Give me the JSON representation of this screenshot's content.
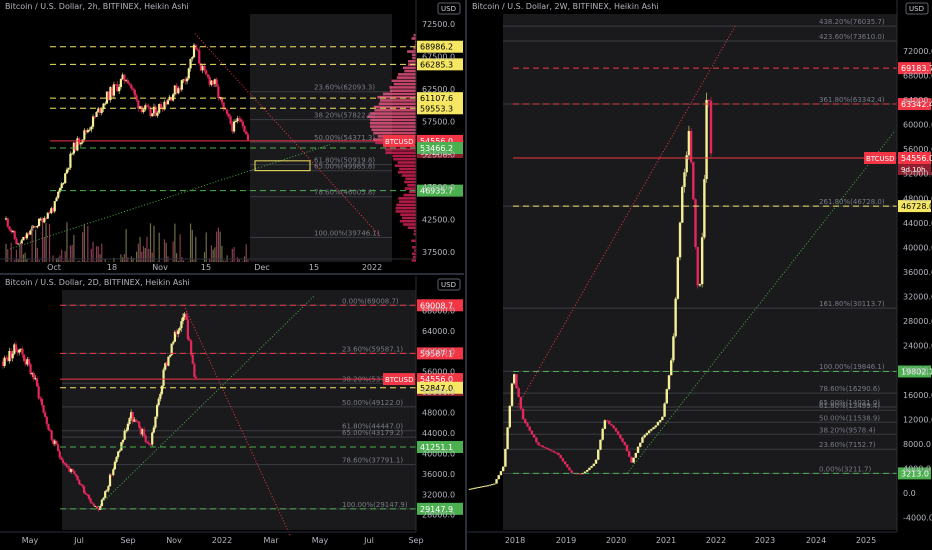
{
  "theme": {
    "bull": "#f5f097",
    "bear": "#e8265e",
    "green": "#4caf50",
    "red": "#f23645",
    "yellow": "#f5e663",
    "fib": "#787b86"
  },
  "charts": {
    "p1": {
      "title": "Bitcoin / U.S. Dollar, 2h, BITFINEX, Heikin Ashi",
      "currency": "USD",
      "ymin": 36000,
      "ymax": 74000,
      "xTicks": [
        "Oct",
        "18",
        "Nov",
        "15",
        "Dec",
        "15",
        "2022"
      ],
      "yTicks": [
        "37500.0",
        "42500.0",
        "47500.0",
        "52500.0",
        "57500.0",
        "62500.0",
        "67500.0",
        "72500.0"
      ],
      "fibLabels": [
        "23.60%(62093.3)",
        "38.20%(57822.8)",
        "50.00%(54371.3)",
        "61.80%(50919.8)",
        "65.00%(49985.8)",
        "78.60%(46005.8)",
        "100.00%(39746.1)"
      ],
      "lines": [
        {
          "name": "level-68986",
          "label": "68986.2",
          "price": 68986.2,
          "color": "#f5e663",
          "dash": true
        },
        {
          "name": "level-66285",
          "label": "66285.3",
          "price": 66285.3,
          "color": "#f5e663",
          "dash": true
        },
        {
          "name": "level-61107",
          "label": "61107.6",
          "price": 61107.6,
          "color": "#f5e663",
          "dash": true
        },
        {
          "name": "level-59553",
          "label": "59553.3",
          "price": 59553.3,
          "color": "#f5e663",
          "dash": true
        },
        {
          "name": "level-54556",
          "label": "54556.0",
          "price": 54556.0,
          "color": "#f23645",
          "dash": false
        },
        {
          "name": "level-53466",
          "label": "53466.2",
          "price": 53466.2,
          "color": "#4caf50",
          "dash": true
        },
        {
          "name": "level-46935",
          "label": "46935.7",
          "price": 46935.7,
          "color": "#4caf50",
          "dash": true
        }
      ],
      "current": {
        "symbol": "BTCUSD",
        "price": "54556.0",
        "countdown": "01:13:05"
      }
    },
    "p2": {
      "title": "Bitcoin / U.S. Dollar, 2D, BITFINEX, Heikin Ashi",
      "currency": "USD",
      "ymin": 25000,
      "ymax": 72000,
      "xTicks": [
        "May",
        "Jul",
        "Sep",
        "Nov",
        "2022",
        "Mar",
        "May",
        "Jul",
        "Sep"
      ],
      "yTicks": [
        "28000.0",
        "32000.0",
        "36000.0",
        "40000.0",
        "44000.0",
        "48000.0",
        "52000.0",
        "56000.0",
        "60000.0",
        "64000.0",
        "68000.0"
      ],
      "fibLabels": [
        "0.00%(69008.7)",
        "23.60%(59587.1)",
        "38.20%(53737.0)",
        "50.00%(49122.0)",
        "61.80%(44447.0)",
        "65.00%(43179.2)",
        "78.60%(37791.1)",
        "100.00%(29147.9)"
      ],
      "lines": [
        {
          "name": "level-69008",
          "label": "69008.7",
          "price": 69008.7,
          "color": "#f23645",
          "dash": true
        },
        {
          "name": "level-59587",
          "label": "59587.1",
          "price": 59587.1,
          "color": "#f23645",
          "dash": true
        },
        {
          "name": "level-54556",
          "label": "54556.0",
          "price": 54556.0,
          "color": "#f23645",
          "dash": false
        },
        {
          "name": "level-52847",
          "label": "52847.0",
          "price": 52847.0,
          "color": "#f5e663",
          "dash": true
        },
        {
          "name": "level-41251",
          "label": "41251.1",
          "price": 41251.1,
          "color": "#4caf50",
          "dash": true
        },
        {
          "name": "level-29147",
          "label": "29147.9",
          "price": 29147.9,
          "color": "#4caf50",
          "dash": true
        }
      ],
      "current": {
        "symbol": "BTCUSD",
        "price": "54556.0",
        "countdown": "09:13:05"
      }
    },
    "p3": {
      "title": "Bitcoin / U.S. Dollar, 2W, BITFINEX, Heikin Ashi",
      "currency": "USD",
      "ymin": -6000,
      "ymax": 78000,
      "xTicks": [
        "2018",
        "2019",
        "2020",
        "2021",
        "2022",
        "2023",
        "2024",
        "2025"
      ],
      "yTicks": [
        "-4000.0",
        "0.0",
        "4000.0",
        "8000.0",
        "12000.0",
        "16000.0",
        "20000.0",
        "24000.0",
        "28000.0",
        "32000.0",
        "36000.0",
        "40000.0",
        "44000.0",
        "48000.0",
        "52000.0",
        "56000.0",
        "60000.0",
        "64000.0",
        "68000.0",
        "72000.0"
      ],
      "fibLabels": [
        "438.20%(76035.7)",
        "423.60%(73610.0)",
        "361.80%(63342.4)",
        "261.80%(46728.0)",
        "161.80%(30113.7)",
        "100.00%(19846.1)",
        "78.60%(16290.6)",
        "65.00%(14031.0)",
        "61.80%(13499.4)",
        "50.00%(11538.9)",
        "38.20%(9578.4)",
        "23.60%(7152.7)",
        "0.00%(3211.7)"
      ],
      "lines": [
        {
          "name": "level-69183",
          "label": "69183.7",
          "price": 69183.7,
          "color": "#f23645",
          "dash": true
        },
        {
          "name": "level-63342",
          "label": "63342.4",
          "price": 63342.4,
          "color": "#f23645",
          "dash": true
        },
        {
          "name": "level-54556",
          "label": "54556.0",
          "price": 54556.0,
          "color": "#f23645",
          "dash": false
        },
        {
          "name": "level-46728",
          "label": "46728.0",
          "price": 46728.0,
          "color": "#f5e663",
          "dash": true
        },
        {
          "name": "level-19802",
          "label": "19802.1",
          "price": 19802.1,
          "color": "#4caf50",
          "dash": true
        },
        {
          "name": "level-3213",
          "label": "3213.0",
          "price": 3213.0,
          "color": "#4caf50",
          "dash": true
        }
      ],
      "current": {
        "symbol": "BTCUSD",
        "price": "54556.0",
        "countdown": "9d 10h"
      }
    }
  },
  "chart_data": [
    {
      "type": "candlestick",
      "title": "Bitcoin / U.S. Dollar, 2h, BITFINEX, Heikin Ashi",
      "timeframe": "2h",
      "ylim": [
        36000,
        74000
      ],
      "x_ticks": [
        "Oct",
        "18",
        "Nov",
        "15",
        "Dec",
        "15",
        "2022"
      ],
      "close_path": [
        [
          "Sep 27",
          42500
        ],
        [
          "Oct 1",
          44000
        ],
        [
          "Oct 5",
          50500
        ],
        [
          "Oct 8",
          54500
        ],
        [
          "Oct 12",
          56500
        ],
        [
          "Oct 16",
          61000
        ],
        [
          "Oct 20",
          65500
        ],
        [
          "Oct 24",
          61500
        ],
        [
          "Oct 28",
          60000
        ],
        [
          "Nov 1",
          61000
        ],
        [
          "Nov 5",
          62000
        ],
        [
          "Nov 9",
          67500
        ],
        [
          "Nov 10",
          68986
        ],
        [
          "Nov 13",
          64000
        ],
        [
          "Nov 16",
          60000
        ],
        [
          "Nov 19",
          57000
        ],
        [
          "Nov 22",
          56500
        ],
        [
          "Nov 25",
          58500
        ],
        [
          "Nov 27",
          54556
        ]
      ],
      "current_price": 54556.0
    },
    {
      "type": "candlestick",
      "title": "Bitcoin / U.S. Dollar, 2D, BITFINEX, Heikin Ashi",
      "timeframe": "2D",
      "ylim": [
        25000,
        72000
      ],
      "x_ticks": [
        "May",
        "Jul",
        "Sep",
        "Nov",
        "2022",
        "Mar",
        "May",
        "Jul",
        "Sep"
      ],
      "close_path": [
        [
          "Apr 2021",
          58000
        ],
        [
          "May 2021",
          49000
        ],
        [
          "Jun 2021",
          35000
        ],
        [
          "Jul 2021",
          31000
        ],
        [
          "Jul 20 2021",
          29148
        ],
        [
          "Aug 2021",
          44000
        ],
        [
          "Sep 2021",
          47000
        ],
        [
          "Sep 28 2021",
          41251
        ],
        [
          "Oct 2021",
          61000
        ],
        [
          "Nov 10 2021",
          69008
        ],
        [
          "Nov 20 2021",
          58000
        ],
        [
          "Nov 27 2021",
          54556
        ]
      ],
      "current_price": 54556.0
    },
    {
      "type": "candlestick",
      "title": "Bitcoin / U.S. Dollar, 2W, BITFINEX, Heikin Ashi",
      "timeframe": "2W",
      "ylim": [
        -6000,
        78000
      ],
      "x_ticks": [
        "2018",
        "2019",
        "2020",
        "2021",
        "2022",
        "2023",
        "2024",
        "2025"
      ],
      "close_path": [
        [
          "2017-09",
          4500
        ],
        [
          "2017-12",
          19802
        ],
        [
          "2018-06",
          7000
        ],
        [
          "2018-12",
          3213
        ],
        [
          "2019-06",
          12000
        ],
        [
          "2019-12",
          7200
        ],
        [
          "2020-03",
          5000
        ],
        [
          "2020-09",
          10500
        ],
        [
          "2020-12",
          23000
        ],
        [
          "2021-04",
          60000
        ],
        [
          "2021-07",
          31000
        ],
        [
          "2021-11",
          69183
        ],
        [
          "2021-11-27",
          54556
        ]
      ],
      "current_price": 54556.0
    }
  ]
}
